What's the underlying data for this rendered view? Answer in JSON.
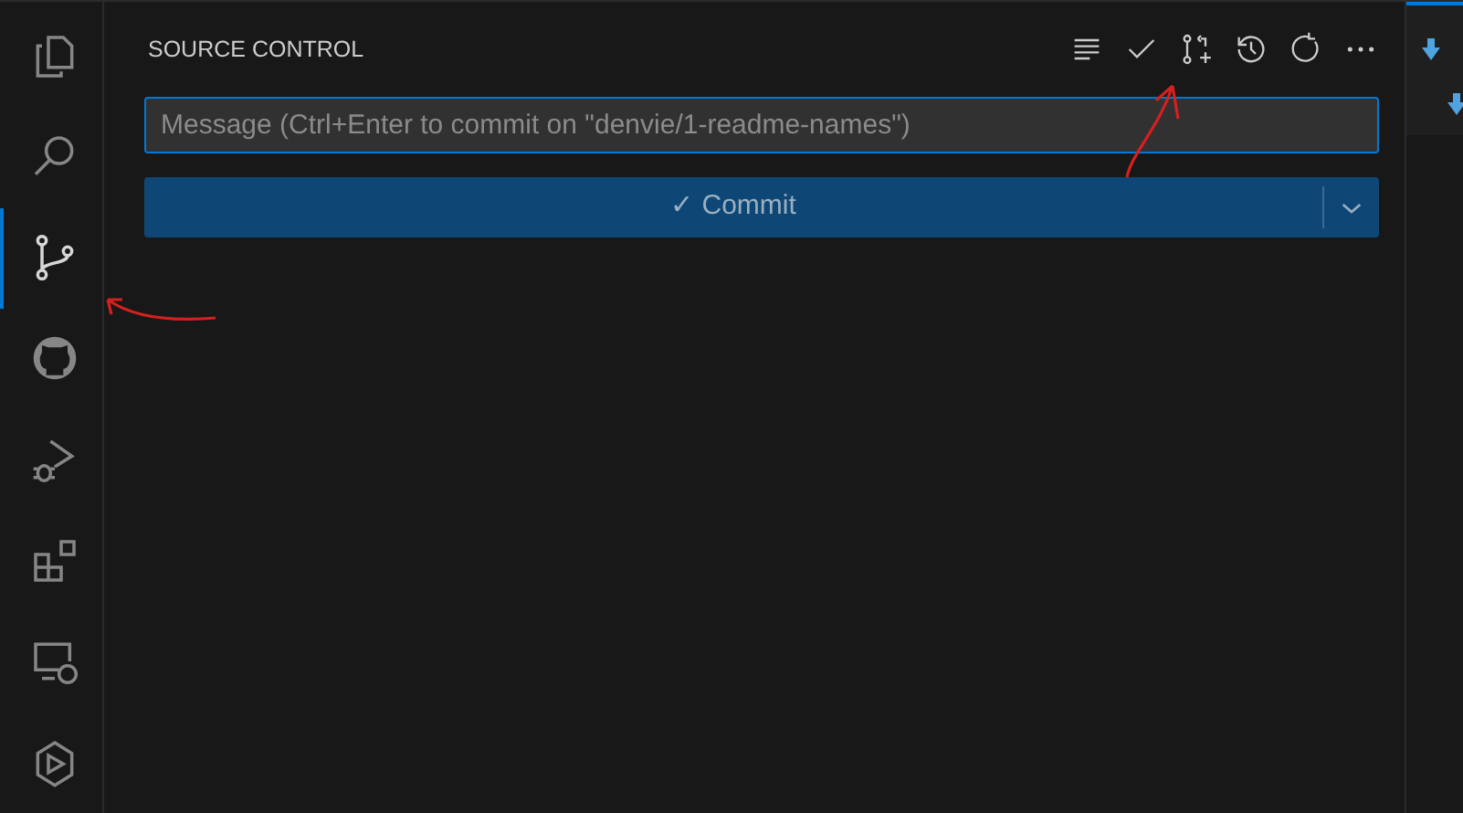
{
  "activity_bar": {
    "items": [
      {
        "kind": "explorer",
        "selected": false
      },
      {
        "kind": "search",
        "selected": false
      },
      {
        "kind": "source-control",
        "selected": true
      },
      {
        "kind": "github",
        "selected": false
      },
      {
        "kind": "run-debug",
        "selected": false
      },
      {
        "kind": "extensions",
        "selected": false
      },
      {
        "kind": "remote",
        "selected": false
      },
      {
        "kind": "deploy",
        "selected": false
      }
    ]
  },
  "sidebar": {
    "title": "SOURCE CONTROL",
    "message": {
      "placeholder": "Message (Ctrl+Enter to commit on \"denvie/1-readme-names\")"
    },
    "commit_button": {
      "label": "✓ Commit"
    }
  }
}
